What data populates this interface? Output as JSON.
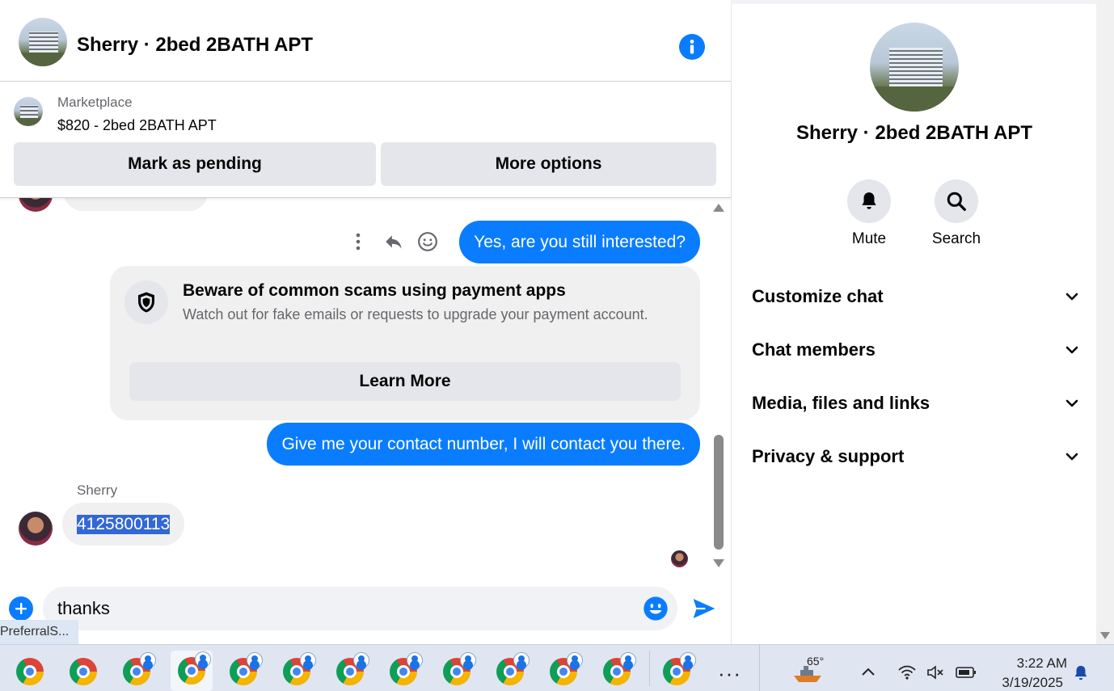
{
  "header": {
    "title": "Sherry · 2bed 2BATH APT"
  },
  "marketplace": {
    "label": "Marketplace",
    "listing": "$820 - 2bed 2BATH APT",
    "buttons": {
      "pending": "Mark as pending",
      "more": "More options"
    }
  },
  "messages": {
    "outgoing_1": "Yes, are you still interested?",
    "scam_card": {
      "title": "Beware of common scams using payment apps",
      "description": "Watch out for fake emails or requests to upgrade your payment account.",
      "button": "Learn More"
    },
    "outgoing_2": "Give me your contact number, I will contact you there.",
    "sender_name": "Sherry",
    "incoming_1": "4125800113"
  },
  "composer": {
    "value": "thanks"
  },
  "tooltip": "PreferralS...",
  "right_panel": {
    "title": "Sherry · 2bed 2BATH APT",
    "actions": {
      "mute": "Mute",
      "search": "Search"
    },
    "sections": {
      "customize": "Customize chat",
      "members": "Chat members",
      "media": "Media, files and links",
      "privacy": "Privacy & support"
    }
  },
  "taskbar": {
    "weather_temp": "65°",
    "time": "3:22 AM",
    "date": "3/19/2025",
    "more": "···"
  },
  "colors": {
    "accent": "#0a7cff",
    "bubble_incoming": "#f0f0f0",
    "button_grey": "#e4e6eb",
    "selection": "#3367d6"
  }
}
